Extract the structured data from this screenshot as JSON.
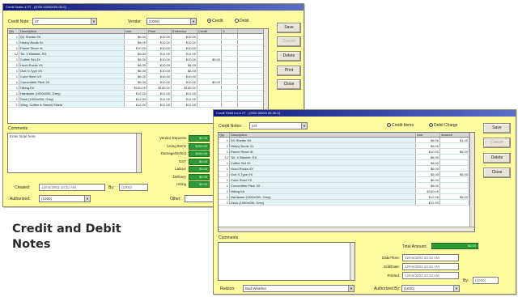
{
  "caption": {
    "line1": "Credit and Debit",
    "line2": "Notes"
  },
  "back_window": {
    "title": "Credit Notes # 3T -  (0000-00000000-00-0)",
    "credit_note_label": "Credit Note:",
    "credit_note_value": "3T",
    "vendor_label": "Vendor:",
    "vendor_value": "(1000)",
    "radio_credit": "Credit",
    "radio_debit": "Debit",
    "columns": [
      "Qty",
      "Description",
      "Unit",
      "Price",
      "Extended",
      "Credit",
      "S"
    ],
    "rows": [
      {
        "qty": "1",
        "desc": "DX Shelter Kit",
        "unit": "$6.00",
        "price": "$10.00",
        "ext": "$10.00",
        "credit": ""
      },
      {
        "qty": "1",
        "desc": "Heavy Boots XL",
        "unit": "$6.00",
        "price": "$10.00",
        "ext": "$10.00",
        "credit": ""
      },
      {
        "qty": "1",
        "desc": "Parcel Stove 4L",
        "unit": "$10.00",
        "price": "$10.00",
        "ext": "$10.00",
        "credit": ""
      },
      {
        "qty": "12",
        "desc": "Tel. V Blanket, RX",
        "unit": "$6.00",
        "price": "$12.00",
        "ext": "$12.00",
        "credit": ""
      },
      {
        "qty": "1",
        "desc": "Coffee Set 4X",
        "unit": "$6.00",
        "price": "$10.00",
        "ext": "$10.00",
        "credit": "$5.00"
      },
      {
        "qty": "1",
        "desc": "Hood Rucks 4X",
        "unit": "$6.00",
        "price": "$10.00",
        "ext": "$6.00",
        "credit": ""
      },
      {
        "qty": "1",
        "desc": "Outl X-Type 9X",
        "unit": "$6.00",
        "price": "$10.00",
        "ext": "$6.00",
        "credit": ""
      },
      {
        "qty": "1",
        "desc": "Cube Steel VX",
        "unit": "$6.00",
        "price": "$10.00",
        "ext": "$10.00",
        "credit": ""
      },
      {
        "qty": "1",
        "desc": "Convertible Pitch 3X",
        "unit": "$6.00",
        "price": "$10.00",
        "ext": "$10.00",
        "credit": "$5.00"
      },
      {
        "qty": "1",
        "desc": "Hiking Kit",
        "unit": "$100.00",
        "price": "$100.00",
        "ext": "$100.00",
        "credit": ""
      },
      {
        "qty": "1",
        "desc": "Hardware (1000x000, Grey)",
        "unit": "$12.00",
        "price": "$12.00",
        "ext": "$12.00",
        "credit": ""
      },
      {
        "qty": "1",
        "desc": "Deck (1000x000, Grey)",
        "unit": "$12.00",
        "price": "$12.00",
        "ext": "$12.00",
        "credit": ""
      },
      {
        "qty": "1",
        "desc": "Wing, Coffee & Stencil Shield",
        "unit": "$12.00",
        "price": "$12.00",
        "ext": "$12.00",
        "credit": ""
      }
    ],
    "comments_label": "Comments",
    "comments_text": "Enter Note here",
    "totals": [
      {
        "label": "Vendor Deposits",
        "value": "$0.00"
      },
      {
        "label": "Using Items",
        "value": "$200.00"
      },
      {
        "label": "Damage/Defect",
        "value": "$200.00"
      },
      {
        "label": "GST",
        "value": "$0.00"
      },
      {
        "label": "Labour",
        "value": "$0.00"
      },
      {
        "label": "Delivery",
        "value": "$0.00"
      },
      {
        "label": "Hiring",
        "value": "$0.00"
      }
    ],
    "created_label": "Created:",
    "created_value": "12/04/2003 10:32 AM",
    "by_label": "By:",
    "by_value": "(1000)",
    "authorized_label": "Authorized:",
    "authorized_value": "(1000)",
    "other_label": "Other:",
    "buttons": {
      "save": "Save",
      "cancel": "Cancel",
      "delete": "Delete",
      "print": "Print",
      "close": "Close"
    }
  },
  "front_window": {
    "title": "Credit Debit Inv # 2T -  (0000-00000 00-00-0)",
    "credit_note_label": "Credit Notes:",
    "credit_note_value": "2/3",
    "check_credit": "Credit Items",
    "check_debit": "Debit Charge",
    "columns": [
      "Qty",
      "Description",
      "Unit",
      "Amount"
    ],
    "rows": [
      {
        "qty": "1",
        "desc": "DX Shelter Kit",
        "unit": "$6.00",
        "amount": "$1.40"
      },
      {
        "qty": "1",
        "desc": "Heavy Boots XL",
        "unit": "$6.00",
        "amount": ""
      },
      {
        "qty": "1",
        "desc": "Parcel Stove 4L",
        "unit": "$10.00",
        "amount": "$5.00"
      },
      {
        "qty": "12",
        "desc": "Tel. V Blanket, RX",
        "unit": "$6.00",
        "amount": ""
      },
      {
        "qty": "1",
        "desc": "Coffee Set 4X",
        "unit": "$6.00",
        "amount": ""
      },
      {
        "qty": "1",
        "desc": "Hood Rucks 4X",
        "unit": "$6.00",
        "amount": ""
      },
      {
        "qty": "1",
        "desc": "Outl X-Type 9X",
        "unit": "$6.00",
        "amount": "$5.00"
      },
      {
        "qty": "1",
        "desc": "Cube Steel VX",
        "unit": "$6.00",
        "amount": ""
      },
      {
        "qty": "1",
        "desc": "Convertible Pitch 3X",
        "unit": "$6.00",
        "amount": ""
      },
      {
        "qty": "1",
        "desc": "Hiking Kit",
        "unit": "$100.00",
        "amount": ""
      },
      {
        "qty": "1",
        "desc": "Hardware (1000x000, Grey)",
        "unit": "$12.00",
        "amount": "$6.00"
      },
      {
        "qty": "1",
        "desc": "Deck (1000x000, Grey)",
        "unit": "$12.00",
        "amount": ""
      }
    ],
    "comments_label": "Comments",
    "total_label": "Total Amount:",
    "total_value": "$0.00",
    "date_rows": [
      {
        "label": "Date/Time:",
        "value": "12/04/2003 10:32 AM"
      },
      {
        "label": "Edit/Date:",
        "value": "12/04/2003 10:32 AM"
      },
      {
        "label": "Printed:",
        "value": "12/04/2003 10:32 AM"
      }
    ],
    "by_label": "By:",
    "by_value": "(1000)",
    "reason_label": "Reason:",
    "reason_value": "Bad Weather",
    "authorized_label": "Authorized By:",
    "authorized_value": "(1000)",
    "buttons": {
      "save": "Save",
      "cancel": "Cancel",
      "delete": "Delete",
      "close": "Close"
    }
  }
}
